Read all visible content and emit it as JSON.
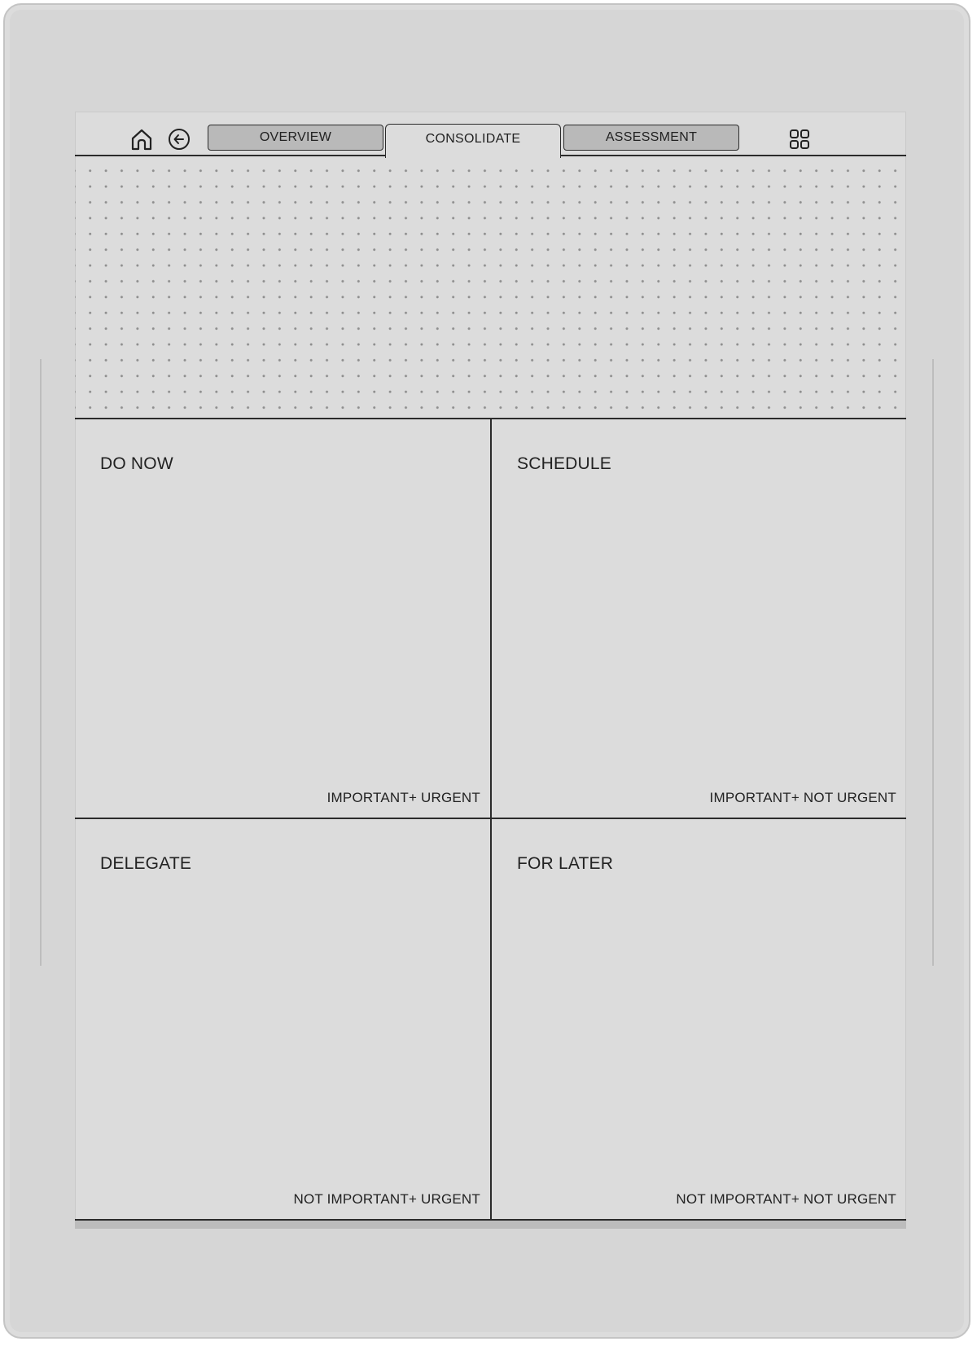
{
  "toolbar": {
    "icons": {
      "home": "home-icon",
      "back": "back-arrow-icon",
      "grid": "grid-icon"
    },
    "tabs": [
      {
        "label": "OVERVIEW",
        "active": false
      },
      {
        "label": "CONSOLIDATE",
        "active": true
      },
      {
        "label": "ASSESSMENT",
        "active": false
      }
    ]
  },
  "matrix": {
    "quadrants": [
      {
        "title": "DO NOW",
        "tag": "IMPORTANT+ URGENT"
      },
      {
        "title": "SCHEDULE",
        "tag": "IMPORTANT+ NOT URGENT"
      },
      {
        "title": "DELEGATE",
        "tag": "NOT IMPORTANT+ URGENT"
      },
      {
        "title": "FOR LATER",
        "tag": "NOT IMPORTANT+ NOT URGENT"
      }
    ]
  },
  "colors": {
    "screen": "#dcdcdc",
    "ink": "#2b2b2b",
    "inactive_tab": "#b9b9b9"
  }
}
